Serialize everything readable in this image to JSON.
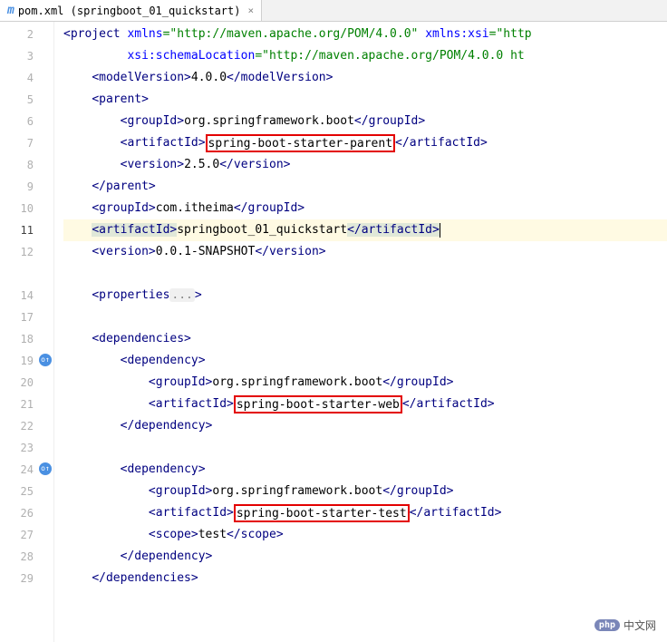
{
  "tab": {
    "icon": "m",
    "label": "pom.xml (springboot_01_quickstart)",
    "close": "×"
  },
  "gutter": {
    "lines": [
      "2",
      "3",
      "4",
      "5",
      "6",
      "7",
      "8",
      "9",
      "10",
      "11",
      "12",
      "",
      "14",
      "17",
      "18",
      "19",
      "20",
      "21",
      "22",
      "23",
      "24",
      "25",
      "26",
      "27",
      "28",
      "29"
    ]
  },
  "code": {
    "l2a": "<project ",
    "l2b": "xmlns",
    "l2c": "=\"http://maven.apache.org/POM/4.0.0\" ",
    "l2d": "xmlns:xsi",
    "l2e": "=\"http",
    "l3a": "         xsi:schemaLocation",
    "l3b": "=\"http://maven.apache.org/POM/4.0.0 ht",
    "l4o": "<modelVersion>",
    "l4t": "4.0.0",
    "l4c": "</modelVersion>",
    "l5o": "<parent>",
    "l6o": "<groupId>",
    "l6t": "org.springframework.boot",
    "l6c": "</groupId>",
    "l7o": "<artifactId>",
    "l7t": "spring-boot-starter-parent",
    "l7c": "</artifactId>",
    "l8o": "<version>",
    "l8t": "2.5.0",
    "l8c": "</version>",
    "l9c": "</parent>",
    "l10o": "<groupId>",
    "l10t": "com.itheima",
    "l10c": "</groupId>",
    "l11o": "<artifactId>",
    "l11t": "springboot_01_quickstart",
    "l11c": "</artifactId>",
    "l12o": "<version>",
    "l12t": "0.0.1-SNAPSHOT",
    "l12c": "</version>",
    "l14o": "<properties",
    "l14e": "...",
    "l14c": ">",
    "l18o": "<dependencies>",
    "l19o": "<dependency>",
    "l20o": "<groupId>",
    "l20t": "org.springframework.boot",
    "l20c": "</groupId>",
    "l21o": "<artifactId>",
    "l21t": "spring-boot-starter-web",
    "l21c": "</artifactId>",
    "l22c": "</dependency>",
    "l24o": "<dependency>",
    "l25o": "<groupId>",
    "l25t": "org.springframework.boot",
    "l25c": "</groupId>",
    "l26o": "<artifactId>",
    "l26t": "spring-boot-starter-test",
    "l26c": "</artifactId>",
    "l27o": "<scope>",
    "l27t": "test",
    "l27c": "</scope>",
    "l28c": "</dependency>",
    "l29c": "</dependencies>"
  },
  "watermark": {
    "php": "php",
    "text": "中文网"
  },
  "chart_data": {
    "type": "table",
    "title": "Maven pom.xml",
    "project_attrs": {
      "xmlns": "http://maven.apache.org/POM/4.0.0",
      "xmlns:xsi": "http",
      "xsi:schemaLocation": "http://maven.apache.org/POM/4.0.0 ht"
    },
    "modelVersion": "4.0.0",
    "parent": {
      "groupId": "org.springframework.boot",
      "artifactId": "spring-boot-starter-parent",
      "version": "2.5.0"
    },
    "groupId": "com.itheima",
    "artifactId": "springboot_01_quickstart",
    "version": "0.0.1-SNAPSHOT",
    "dependencies": [
      {
        "groupId": "org.springframework.boot",
        "artifactId": "spring-boot-starter-web"
      },
      {
        "groupId": "org.springframework.boot",
        "artifactId": "spring-boot-starter-test",
        "scope": "test"
      }
    ],
    "highlighted_artifacts": [
      "spring-boot-starter-parent",
      "spring-boot-starter-web",
      "spring-boot-starter-test"
    ],
    "current_line": 11
  }
}
